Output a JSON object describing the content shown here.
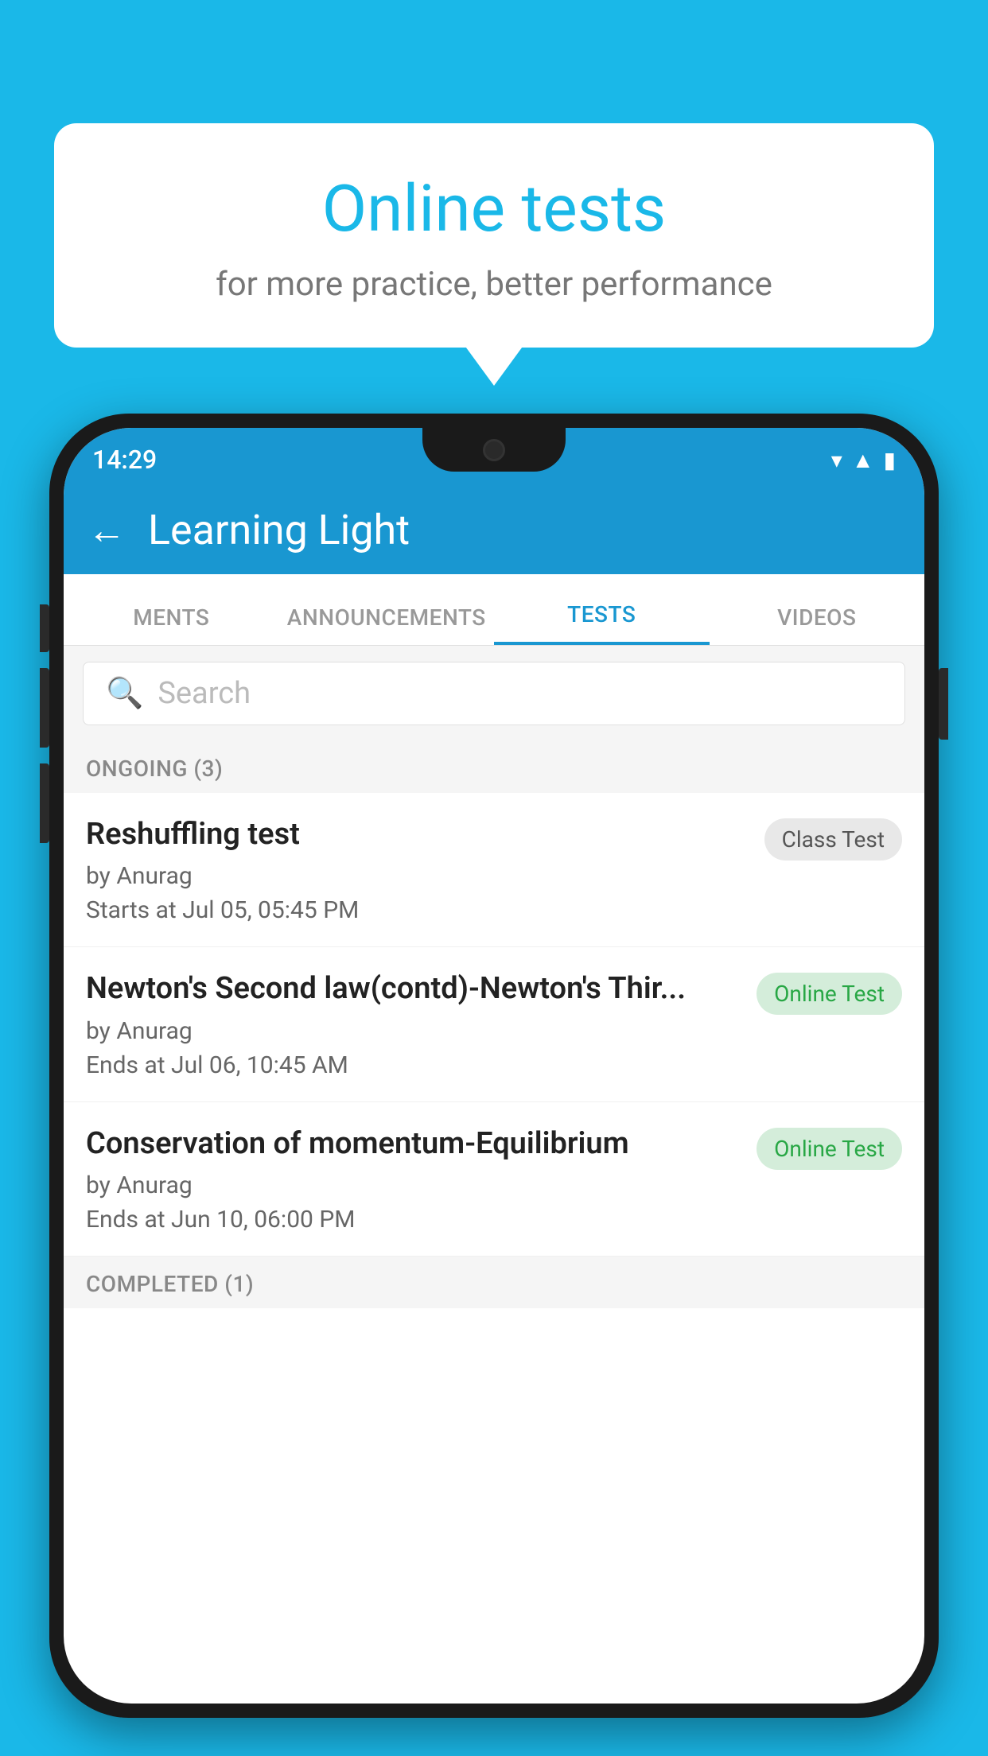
{
  "background_color": "#1ab8e8",
  "bubble": {
    "title": "Online tests",
    "subtitle": "for more practice, better performance"
  },
  "phone": {
    "status_bar": {
      "time": "14:29",
      "icons": [
        "wifi",
        "signal",
        "battery"
      ]
    },
    "app_bar": {
      "title": "Learning Light",
      "back_label": "←"
    },
    "tabs": [
      {
        "label": "MENTS",
        "active": false
      },
      {
        "label": "ANNOUNCEMENTS",
        "active": false
      },
      {
        "label": "TESTS",
        "active": true
      },
      {
        "label": "VIDEOS",
        "active": false
      }
    ],
    "search": {
      "placeholder": "Search"
    },
    "sections": [
      {
        "label": "ONGOING (3)",
        "items": [
          {
            "name": "Reshuffling test",
            "by": "by Anurag",
            "date": "Starts at  Jul 05, 05:45 PM",
            "badge": "Class Test",
            "badge_type": "class"
          },
          {
            "name": "Newton's Second law(contd)-Newton's Thir...",
            "by": "by Anurag",
            "date": "Ends at  Jul 06, 10:45 AM",
            "badge": "Online Test",
            "badge_type": "online"
          },
          {
            "name": "Conservation of momentum-Equilibrium",
            "by": "by Anurag",
            "date": "Ends at  Jun 10, 06:00 PM",
            "badge": "Online Test",
            "badge_type": "online"
          }
        ]
      }
    ],
    "bottom_section_label": "COMPLETED (1)"
  }
}
